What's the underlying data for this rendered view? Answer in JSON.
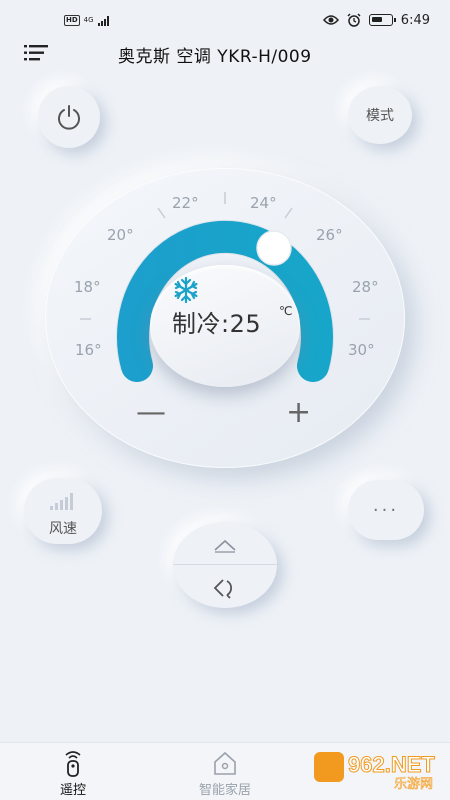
{
  "status_bar": {
    "left_badges": [
      "HD",
      "4G"
    ],
    "time": "6:49"
  },
  "header": {
    "title": "奥克斯 空调 YKR-H/009",
    "menu_icon": "menu-icon"
  },
  "controls": {
    "power_icon": "power-icon",
    "mode_label": "模式",
    "fan_label": "风速",
    "more_label": "···",
    "minus_label": "—",
    "plus_label": "+"
  },
  "dial": {
    "ticks": [
      "16°",
      "18°",
      "20°",
      "22°",
      "24°",
      "26°",
      "28°",
      "30°"
    ],
    "mode_icon": "snowflake-icon",
    "temp_display": "制冷:25",
    "unit": "℃",
    "level": 0.64
  },
  "swing": {
    "up_icon": "swing-vertical-icon",
    "lr_icon": "swing-horizontal-icon"
  },
  "tabs": [
    {
      "label": "遥控",
      "icon": "remote-icon",
      "active": true
    },
    {
      "label": "智能家居",
      "icon": "smart-home-icon",
      "active": false
    }
  ],
  "watermark": {
    "brand": "962.NET",
    "sub": "乐游网"
  },
  "colors": {
    "accent": "#1aa3c8",
    "background": "#eef2f7"
  }
}
